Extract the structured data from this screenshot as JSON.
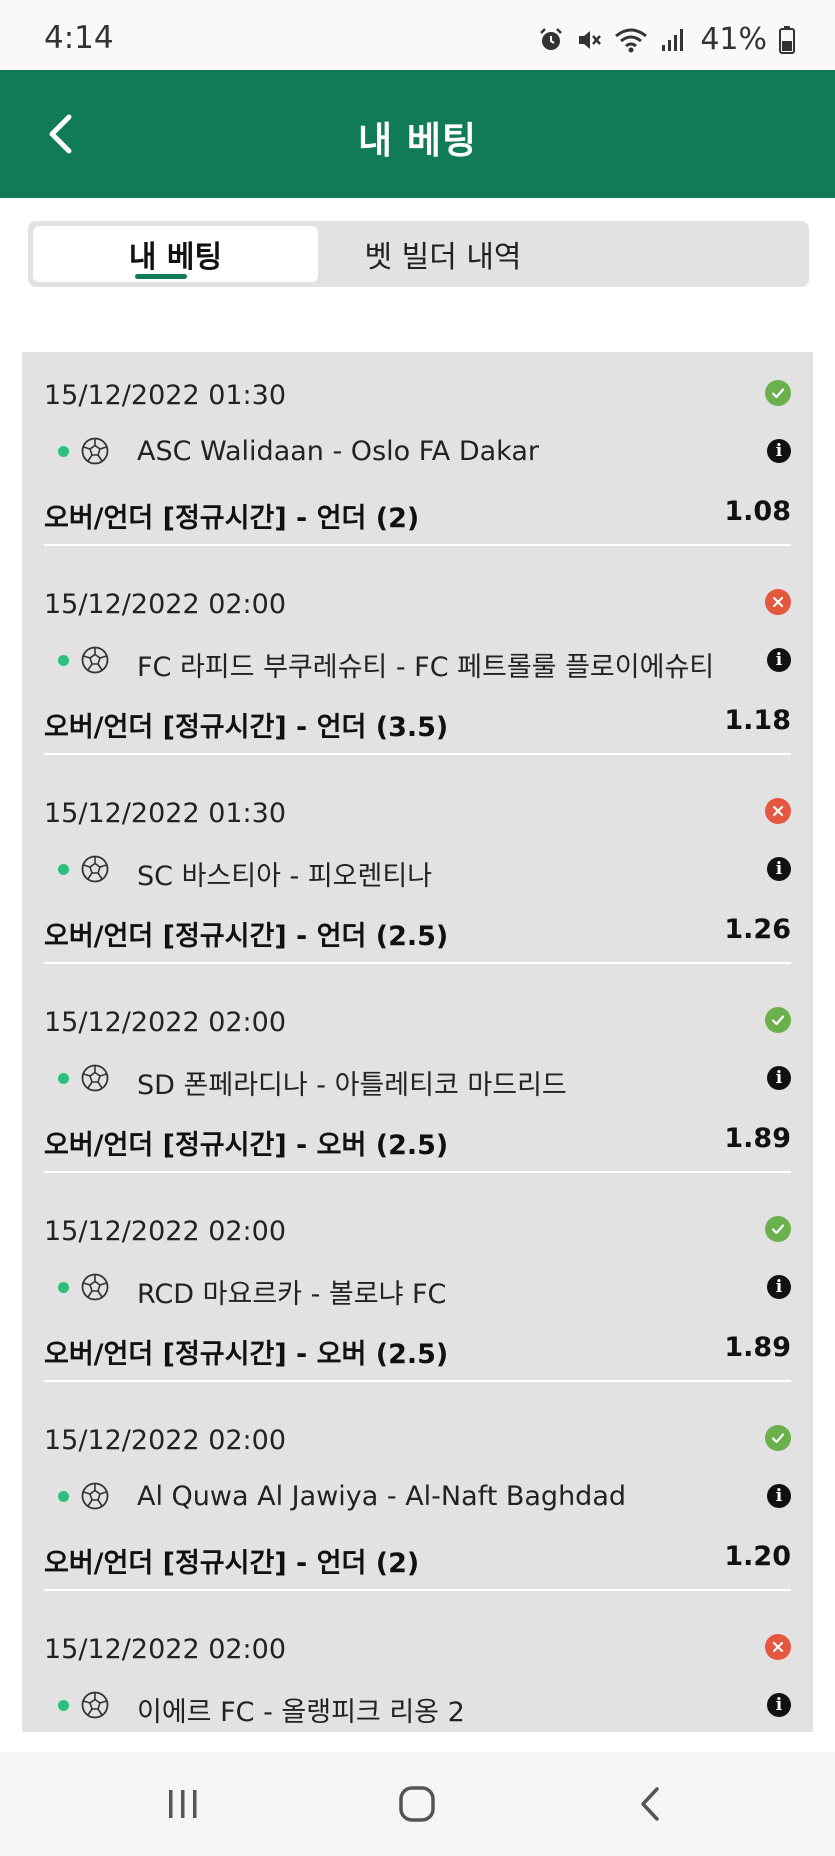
{
  "status_bar": {
    "time": "4:14",
    "battery": "41%"
  },
  "header": {
    "title": "내 베팅"
  },
  "tabs": [
    {
      "label": "내 베팅",
      "active": true
    },
    {
      "label": "벳 빌더 내역",
      "active": false
    }
  ],
  "colors": {
    "brand": "#117a56",
    "win": "#6ab04c",
    "loss": "#e5573f",
    "live": "#2cc07f"
  },
  "bets": [
    {
      "date": "15/12/2022 01:30",
      "status": "win",
      "match": "ASC Walidaan - Oslo FA Dakar",
      "market": "오버/언더 [정규시간] - 언더 (2)",
      "odds": "1.08"
    },
    {
      "date": "15/12/2022 02:00",
      "status": "loss",
      "match": "FC 라피드 부쿠레슈티 - FC 페트롤룰 플로이에슈티",
      "market": "오버/언더 [정규시간] - 언더 (3.5)",
      "odds": "1.18"
    },
    {
      "date": "15/12/2022 01:30",
      "status": "loss",
      "match": "SC 바스티아 - 피오렌티나",
      "market": "오버/언더 [정규시간] - 언더 (2.5)",
      "odds": "1.26"
    },
    {
      "date": "15/12/2022 02:00",
      "status": "win",
      "match": "SD 폰페라디나 - 아틀레티코 마드리드",
      "market": "오버/언더 [정규시간] - 오버 (2.5)",
      "odds": "1.89"
    },
    {
      "date": "15/12/2022 02:00",
      "status": "win",
      "match": "RCD 마요르카 - 볼로냐 FC",
      "market": "오버/언더 [정규시간] - 오버 (2.5)",
      "odds": "1.89"
    },
    {
      "date": "15/12/2022 02:00",
      "status": "win",
      "match": "Al Quwa Al Jawiya - Al-Naft Baghdad",
      "market": "오버/언더 [정규시간] - 언더 (2)",
      "odds": "1.20"
    },
    {
      "date": "15/12/2022 02:00",
      "status": "loss",
      "match": "이에르 FC - 올랭피크 리옹 2",
      "market": "",
      "odds": ""
    }
  ],
  "icons": {
    "back": "chevron-left-icon",
    "win": "check-circle-icon",
    "loss": "x-circle-icon",
    "sport": "soccer-ball-icon",
    "info": "info-icon"
  }
}
